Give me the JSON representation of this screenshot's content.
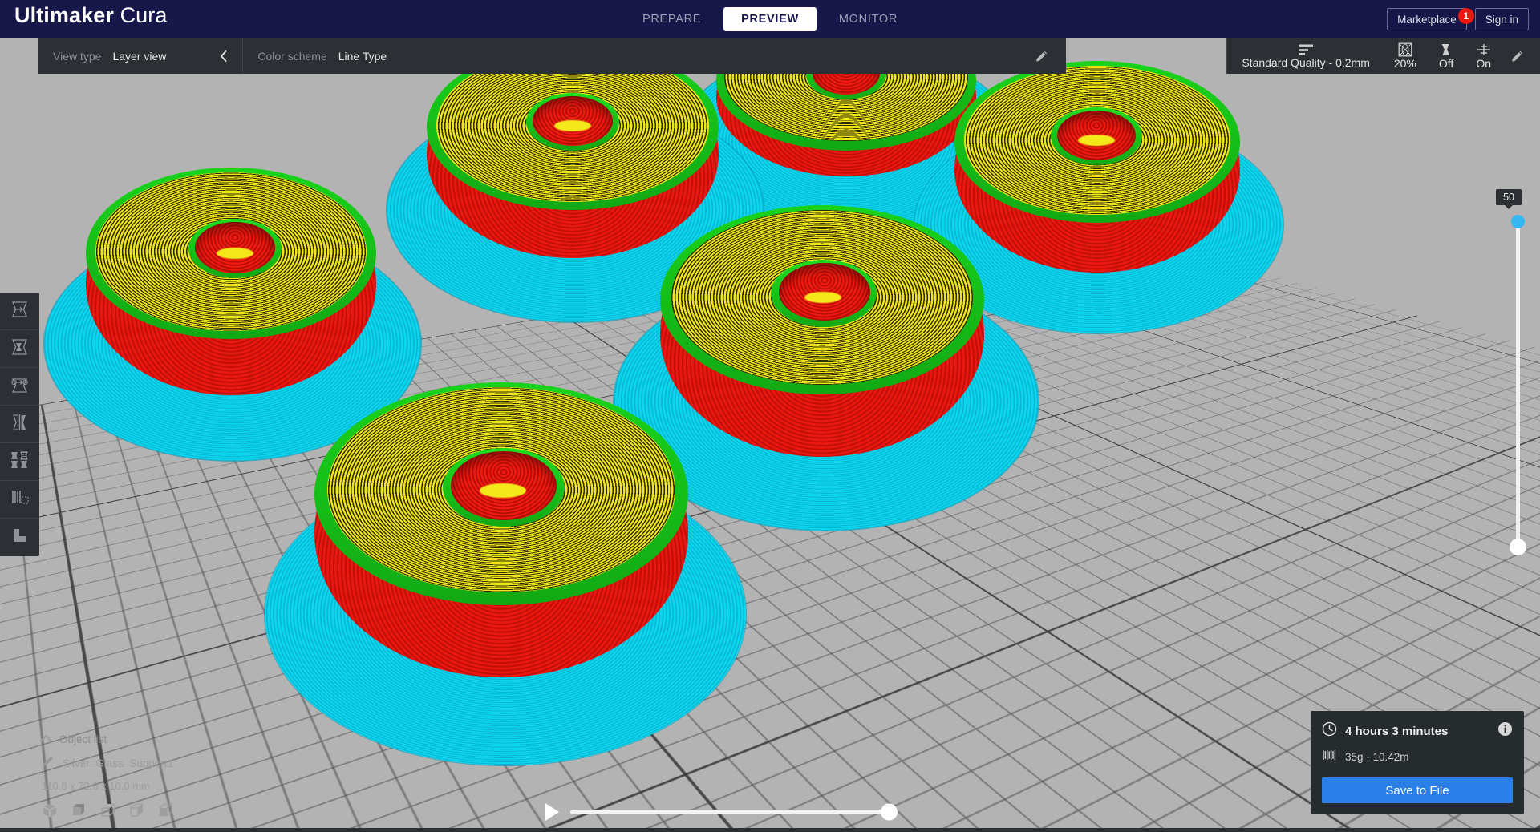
{
  "app": {
    "brand_bold": "Ultimaker",
    "brand_light": "Cura"
  },
  "topbar": {
    "tabs": [
      {
        "label": "PREPARE",
        "active": false
      },
      {
        "label": "PREVIEW",
        "active": true
      },
      {
        "label": "MONITOR",
        "active": false
      }
    ],
    "marketplace_label": "Marketplace",
    "marketplace_badge": "1",
    "signin_label": "Sign in"
  },
  "viewbar": {
    "view_type_label": "View type",
    "view_type_value": "Layer view",
    "collapse_icon": "chevron-left-icon",
    "color_scheme_label": "Color scheme",
    "color_scheme_value": "Line Type",
    "edit_icon": "pencil-icon",
    "profile_icon": "layer-height-icon",
    "profile_value": "Standard Quality - 0.2mm",
    "infill_icon": "infill-icon",
    "infill_value": "20%",
    "support_icon": "support-icon",
    "support_value": "Off",
    "adhesion_icon": "adhesion-icon",
    "adhesion_value": "On",
    "settings_edit_icon": "pencil-icon"
  },
  "toolbar": {
    "tools": [
      {
        "name": "move-tool",
        "icon": "move-icon"
      },
      {
        "name": "scale-tool",
        "icon": "scale-icon"
      },
      {
        "name": "rotate-tool",
        "icon": "rotate-icon"
      },
      {
        "name": "mirror-tool",
        "icon": "mirror-icon"
      },
      {
        "name": "per-model-settings-tool",
        "icon": "per-model-settings-icon"
      },
      {
        "name": "support-blocker-tool",
        "icon": "support-blocker-icon"
      },
      {
        "name": "custom-supports-tool",
        "icon": "custom-supports-icon"
      }
    ]
  },
  "layer_slider": {
    "value_label": "50",
    "upper_handle": "layer-upper-handle",
    "lower_handle": "layer-lower-handle"
  },
  "path_slider": {
    "play_icon": "play-icon",
    "handle": "path-slider-handle"
  },
  "object_list": {
    "title": "Object list",
    "caret_icon": "chevron-up-icon",
    "item_icon": "pencil-icon",
    "item_name": "Silver_Glass_Support1",
    "dimensions": "110.8 x 72.6 x 10.0 mm",
    "view_icons": [
      "view-3d-icon",
      "view-front-icon",
      "view-top-icon",
      "view-left-icon",
      "view-right-icon"
    ]
  },
  "job_panel": {
    "time_icon": "clock-icon",
    "time_text": "4 hours 3 minutes",
    "info_icon": "info-icon",
    "material_icon": "spool-icon",
    "material_text": "35g · 10.42m",
    "save_label": "Save to File"
  },
  "colors": {
    "brand_navy": "#17174a",
    "panel_dark": "#2c3034",
    "accent_blue": "#2a7fe8",
    "slider_blue": "#35b7f0",
    "badge_red": "#e8190f",
    "line_wall_outer": "#e8170f",
    "line_wall_inner": "#19d31b",
    "line_skin": "#f2e516",
    "line_adhesion": "#0ad6f0",
    "plate_gray": "#b3b3b3"
  }
}
